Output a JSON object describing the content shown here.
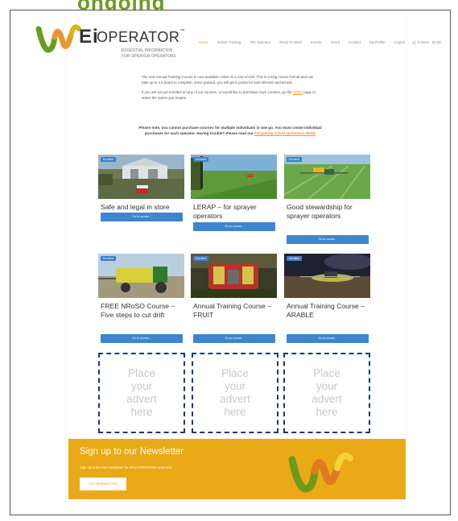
{
  "top_strip_text": "ongoing",
  "header": {
    "logo_ei": "Ei",
    "logo_title": "OPERATOR",
    "logo_tm": "™",
    "logo_sub1": "ESSENTIAL INFORMATION",
    "logo_sub2": "FOR SPRAYER OPERATORS",
    "nav": [
      "Home",
      "Online Training",
      "The Operator",
      "Read To Work",
      "Events",
      "About",
      "Contact",
      "My Profile",
      "Logout"
    ],
    "cart": "0 items - £0.00"
  },
  "intro": {
    "p1": "The new Annual Training Course is now available online at a cost of £20. This is a long course format and can take up to 2.5 hours to complete. Once passed, you will get 6 points for both NRoSO and BASIS.",
    "p2_before": "If you are not yet enrolled on any of our courses, or would like to purchase more courses, go the ",
    "p2_link": "SHOP",
    "p2_after": " page to select the option you require.",
    "notice_before": "Please note, you cannot purchase courses for multiple individuals in one go. You must create individual purchases for each operator. Having trouble? Please read our ",
    "notice_link": "Frequently Asked Questions HERE"
  },
  "courses": [
    {
      "title": "Safe and legal in store",
      "badge": "Enrolled",
      "button": "Go to course..."
    },
    {
      "title": "LERAP – for sprayer operators",
      "badge": "Enrolled",
      "button": "Go to course..."
    },
    {
      "title": "Good stewardship for sprayer operators",
      "badge": "Enrolled",
      "button": "Go to course..."
    },
    {
      "title": "FREE NRoSO Course – Five steps to cut drift",
      "badge": "Enrolled",
      "button": "Go to course..."
    },
    {
      "title": "Annual Training Course – FRUIT",
      "badge": "Enrolled",
      "button": "Go to course..."
    },
    {
      "title": "Annual Training Course – ARABLE",
      "badge": "Enrolled",
      "button": "Go to course..."
    }
  ],
  "adverts": [
    {
      "l1": "Place",
      "l2": "your",
      "l3": "advert",
      "l4": "here"
    },
    {
      "l1": "Place",
      "l2": "your",
      "l3": "advert",
      "l4": "here"
    },
    {
      "l1": "Place",
      "l2": "your",
      "l3": "advert",
      "l4": "here"
    }
  ],
  "newsletter": {
    "title": "Sign up to our Newsletter",
    "subtitle": "Sign up to the free newsletter for all Ei OPERATOR news and",
    "button": "GET NEWSLETTER"
  },
  "colors": {
    "accent_orange": "#e8962e",
    "button_blue": "#3d86cf",
    "newsletter_bg": "#eaa916",
    "advert_border": "#1e3a63",
    "brand_green": "#6c9a1f"
  }
}
